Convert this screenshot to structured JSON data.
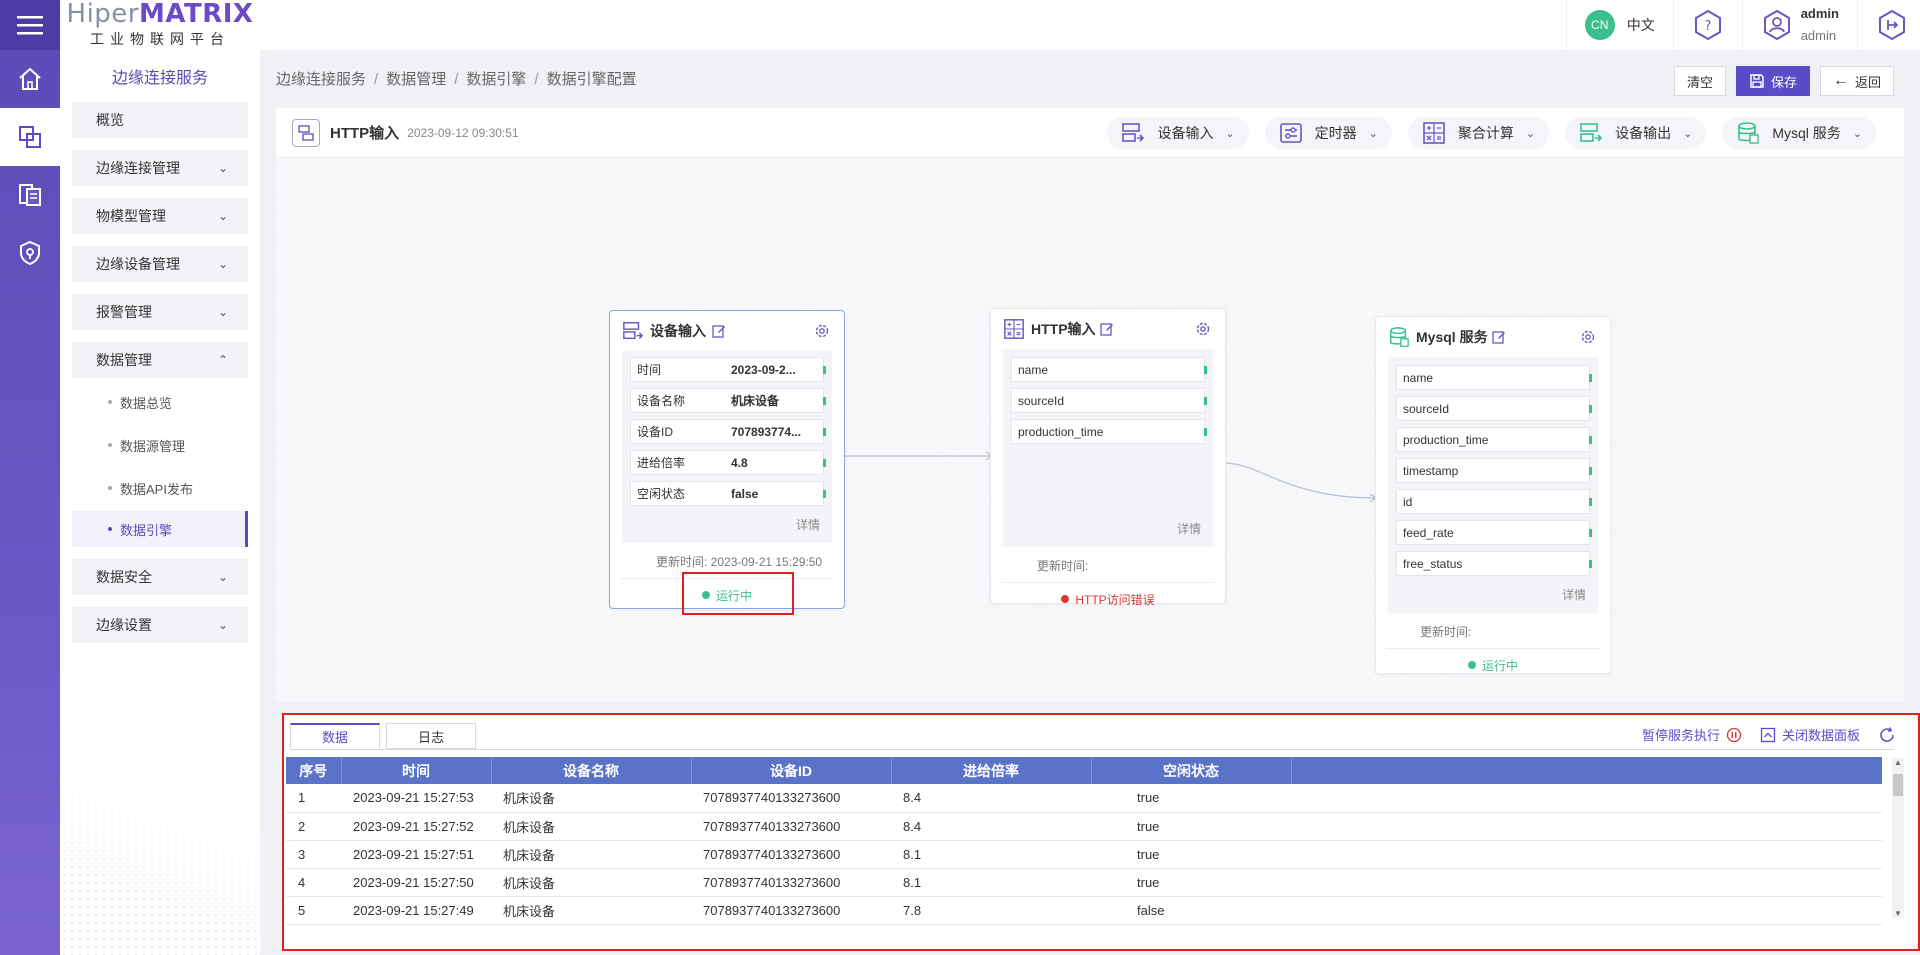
{
  "logo": {
    "part1": "Hiper",
    "part2": "MATRIX",
    "subtitle": "工业物联网平台"
  },
  "rail": {
    "items": [
      "menu-icon",
      "home-icon",
      "edge-connect-icon",
      "data-icon",
      "security-icon"
    ]
  },
  "sidebar": {
    "title": "边缘连接服务",
    "items": {
      "overview": "概览",
      "edge_conn": "边缘连接管理",
      "model": "物模型管理",
      "edge_device": "边缘设备管理",
      "alarm": "报警管理",
      "data_mgmt": "数据管理",
      "data_overview": "数据总览",
      "data_source": "数据源管理",
      "data_api": "数据API发布",
      "data_engine": "数据引擎",
      "data_security": "数据安全",
      "edge_setting": "边缘设置"
    }
  },
  "topbar": {
    "lang_badge": "CN",
    "lang_label": "中文",
    "user_name": "admin",
    "user_role": "admin"
  },
  "breadcrumb": {
    "b1": "边缘连接服务",
    "b2": "数据管理",
    "b3": "数据引擎",
    "b4": "数据引擎配置",
    "sep": "/"
  },
  "actions": {
    "clear": "清空",
    "save": "保存",
    "back": "返回"
  },
  "canvas": {
    "title": "HTTP输入",
    "date": "2023-09-12 09:30:51",
    "tools": {
      "device_input": "设备输入",
      "timer": "定时器",
      "aggregate": "聚合计算",
      "device_output": "设备输出",
      "mysql": "Mysql 服务"
    }
  },
  "nodes": {
    "device_input": {
      "title": "设备输入",
      "fields": [
        {
          "k": "时间",
          "v": "2023-09-2..."
        },
        {
          "k": "设备名称",
          "v": "机床设备"
        },
        {
          "k": "设备ID",
          "v": "707893774..."
        },
        {
          "k": "进给倍率",
          "v": "4.8"
        },
        {
          "k": "空闲状态",
          "v": "false"
        }
      ],
      "detail": "详情",
      "update": "更新时间:  2023-09-21 15:29:50",
      "status": "运行中"
    },
    "http_input": {
      "title": "HTTP输入",
      "fields": [
        "name",
        "sourceId",
        "production_time"
      ],
      "detail": "详情",
      "update": "更新时间:",
      "status": "HTTP访问错误"
    },
    "mysql": {
      "title": "Mysql 服务",
      "fields": [
        "name",
        "sourceId",
        "production_time",
        "timestamp",
        "id",
        "feed_rate",
        "free_status"
      ],
      "detail": "详情",
      "update": "更新时间:",
      "status": "运行中"
    }
  },
  "panel": {
    "tabs": {
      "data": "数据",
      "log": "日志"
    },
    "pause": "暂停服务执行",
    "close": "关闭数据面板",
    "columns": {
      "idx": "序号",
      "time": "时间",
      "name": "设备名称",
      "id": "设备ID",
      "rate": "进给倍率",
      "status": "空闲状态"
    },
    "rows": [
      {
        "idx": "1",
        "time": "2023-09-21 15:27:53",
        "name": "机床设备",
        "id": "7078937740133273600",
        "rate": "8.4",
        "status": "true"
      },
      {
        "idx": "2",
        "time": "2023-09-21 15:27:52",
        "name": "机床设备",
        "id": "7078937740133273600",
        "rate": "8.4",
        "status": "true"
      },
      {
        "idx": "3",
        "time": "2023-09-21 15:27:51",
        "name": "机床设备",
        "id": "7078937740133273600",
        "rate": "8.1",
        "status": "true"
      },
      {
        "idx": "4",
        "time": "2023-09-21 15:27:50",
        "name": "机床设备",
        "id": "7078937740133273600",
        "rate": "8.1",
        "status": "true"
      },
      {
        "idx": "5",
        "time": "2023-09-21 15:27:49",
        "name": "机床设备",
        "id": "7078937740133273600",
        "rate": "7.8",
        "status": "false"
      }
    ]
  },
  "colors": {
    "brand": "#5b4bc9",
    "ok": "#3cbf8f",
    "error": "#d93636",
    "table_head": "#5a72c8"
  }
}
